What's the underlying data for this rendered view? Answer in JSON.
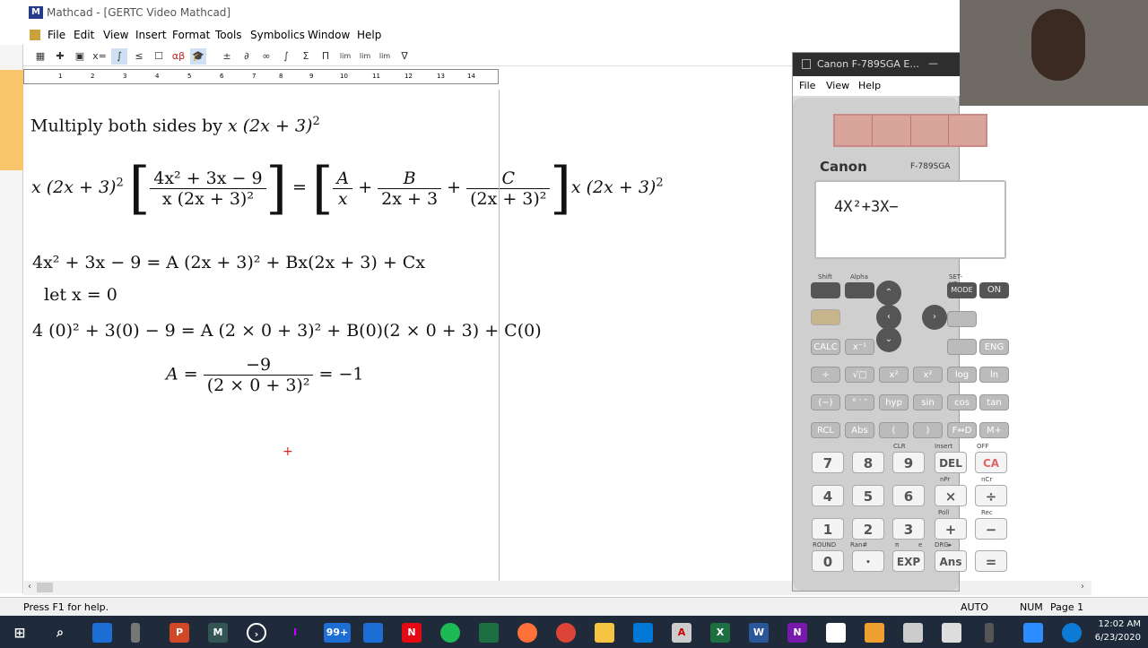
{
  "window": {
    "title": "Mathcad - [GERTC Video Mathcad]"
  },
  "menu": [
    "File",
    "Edit",
    "View",
    "Insert",
    "Format",
    "Tools",
    "Symbolics",
    "Window",
    "Help"
  ],
  "toolbar_symbols": [
    "▦",
    "✚",
    "▣",
    "x=",
    "∫",
    "≤",
    "☐",
    "αβ",
    "🎓",
    "±",
    "∂",
    "∞",
    "∫",
    "Σ",
    "Π",
    "lim",
    "lim",
    "lim",
    "∇"
  ],
  "ruler_ticks": [
    "1",
    "2",
    "3",
    "4",
    "5",
    "6",
    "7",
    "8",
    "9",
    "10",
    "11",
    "12",
    "13",
    "14"
  ],
  "doc": {
    "line1_text": "Multiply both sides by ",
    "line1_math": "x (2x + 3)",
    "line1_exp": "2",
    "eq2": {
      "left": "x (2x + 3)",
      "left_exp": "2",
      "num": "4x² + 3x − 9",
      "den": "x (2x + 3)²",
      "eq": "=",
      "fA_num": "A",
      "fA_den": "x",
      "plus": "+",
      "fB_num": "B",
      "fB_den": "2x + 3",
      "fC_num": "C",
      "fC_den": "(2x + 3)²",
      "right": "x (2x + 3)",
      "right_exp": "2"
    },
    "eq3": "4x² + 3x − 9 = A (2x + 3)² + Bx(2x + 3) + Cx",
    "eq4": "let x = 0",
    "eq5": "4 (0)² + 3(0) − 9 = A (2 × 0 + 3)² + B(0)(2 × 0 + 3) + C(0)",
    "eq6": {
      "lhs": "A",
      "eq": "=",
      "num": "−9",
      "den": "(2 × 0 + 3)²",
      "result": "= −1"
    },
    "cursor": "+"
  },
  "status": {
    "help": "Press F1 for help.",
    "auto": "AUTO",
    "num": "NUM",
    "page": "Page 1"
  },
  "calculator": {
    "title": "Canon F-789SGA E...",
    "minimize": "—",
    "menu": [
      "File",
      "View",
      "Help"
    ],
    "brand": "Canon",
    "model": "F-789SGA",
    "display": "4X²+3X−",
    "top_keys": {
      "shift": "Shift",
      "alpha": "Alpha",
      "mode": "MODE",
      "on": "ON",
      "setup": "SET-UP"
    },
    "row_func1": [
      "CALC",
      "x⁻¹",
      "",
      "",
      "ENG"
    ],
    "row_func2": [
      "÷",
      "√□",
      "x²",
      "x²",
      "log",
      "ln"
    ],
    "row_func3": [
      "(−)",
      "° ′ ″",
      "hyp",
      "sin",
      "cos",
      "tan"
    ],
    "row_func4": [
      "RCL",
      "Abs",
      "(",
      ")",
      "F⇔D",
      "M+"
    ],
    "num_rows": [
      [
        "7",
        "8",
        "9",
        "DEL",
        "CA"
      ],
      [
        "4",
        "5",
        "6",
        "×",
        "÷"
      ],
      [
        "1",
        "2",
        "3",
        "+",
        "−"
      ],
      [
        "0",
        "·",
        "EXP",
        "Ans",
        "="
      ]
    ],
    "key_labels": [
      "CLR",
      "Insert",
      "OFF",
      "nPr",
      "nCr",
      "Poll",
      "Rec",
      "ROUND",
      "Ran#",
      "π",
      "e",
      "DRG▸"
    ]
  },
  "taskbar": {
    "clock_time": "12:02 AM",
    "clock_date": "6/23/2020",
    "badge": "99+"
  }
}
